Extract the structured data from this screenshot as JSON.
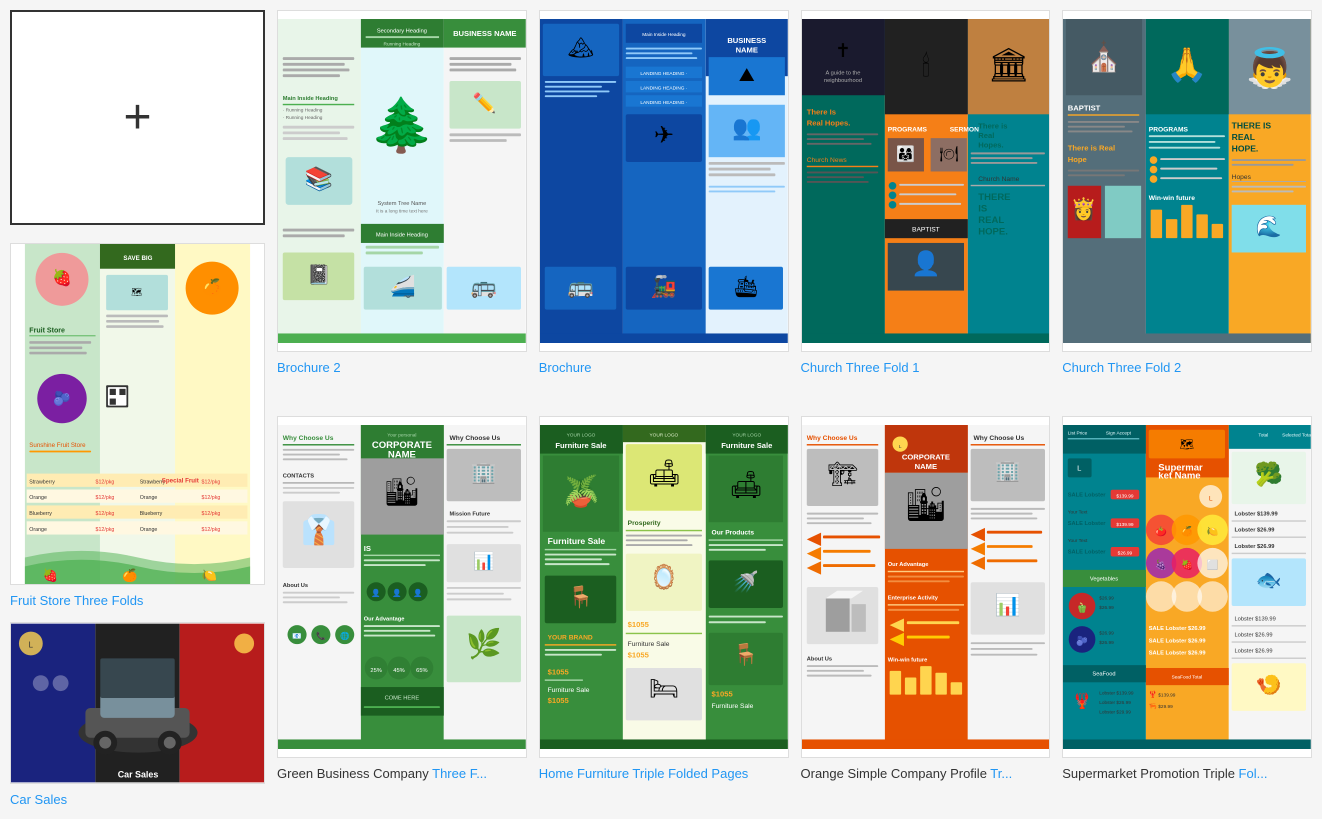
{
  "templates": {
    "new_blank": {
      "label": ""
    },
    "left_col": [
      {
        "id": "fruit-store",
        "label": "Fruit Store Three Folds",
        "label_plain": "Fruit Store Three Folds",
        "has_blue": false
      },
      {
        "id": "car-sales",
        "label": "Car Sales",
        "label_plain": "Car Sales",
        "has_blue": false
      }
    ],
    "row1": [
      {
        "id": "brochure2",
        "label": "Brochure 2",
        "label_plain": "Brochure 2",
        "has_blue": false
      },
      {
        "id": "brochure",
        "label": "Brochure",
        "label_plain": "Brochure",
        "has_blue": false
      },
      {
        "id": "church-fold1",
        "label": "Church Three Fold 1",
        "label_plain": "Church Three Fold 1",
        "has_blue": false
      },
      {
        "id": "church-fold2",
        "label": "Church Three Fold 2",
        "label_plain": "Church Three Fold 2",
        "has_blue": false
      }
    ],
    "row2": [
      {
        "id": "green-biz",
        "label_start": "Green Business Company Three F",
        "label_end": "...",
        "has_blue": true,
        "blue_part": "Three F..."
      },
      {
        "id": "home-furniture",
        "label_start": "Home Furniture Triple Folded Pages",
        "label_end": "",
        "has_blue": true,
        "blue_part": "Home Furniture Triple Folded Pages"
      },
      {
        "id": "orange-corp",
        "label_start": "Orange Simple Company Profile Tr",
        "label_end": "...",
        "has_blue": true,
        "blue_part": "Tr..."
      },
      {
        "id": "supermarket",
        "label_start": "Supermarket Promotion Triple Fol",
        "label_end": "...",
        "has_blue": true,
        "blue_part": "Fol..."
      }
    ]
  }
}
